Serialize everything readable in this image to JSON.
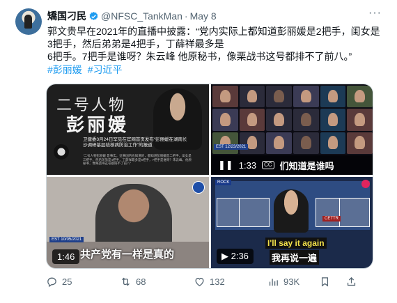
{
  "author": {
    "name": "矯国刁民",
    "handle": "@NFSC_TankMan",
    "separator": "·",
    "date": "May 8"
  },
  "tweet": {
    "lines": [
      "郭文贵早在2021年的直播中披露：“党内实际上都知道彭丽媛是2把手，闺女是",
      "3把手，然后弟弟是4把手，丁薛祥最多是",
      "6把手。7把手是谁呀？朱云峰 他原秘书，像栗战书这号都排不了前八。”"
    ],
    "hashtags": [
      "#彭丽媛",
      "#习近平"
    ]
  },
  "media": {
    "tile1": {
      "heading": "二号人物",
      "name": "彭丽媛",
      "caption": "卫健委3月24日罕见在官网首页发布“彭丽媛在湖南长沙调研基层结核病防治工作”的报道",
      "fine_print": "“二号人物彭丽媛 是事实，这事国内也知道的，都知道彭丽媛是二把手，闺女是三把手，然后弟弟是4把手，丁薛祥最多是6把手，7把手是谁呀？朱云峰，他原秘书，像栗战书这号都排不了前八”"
    },
    "tile2": {
      "est_label": "EST 12/23/2021",
      "duration": "1:33",
      "subtitle": "们知道是谁吗"
    },
    "tile3": {
      "est_label": "EST 10/05/2021",
      "duration": "1:46",
      "subtitle": "共产党有一样是真的"
    },
    "tile4": {
      "network": "ROCK",
      "panel_label": "CETTR",
      "duration": "2:36",
      "subtitle_en": "I'll say it again",
      "subtitle_zh": "我再说一遍"
    }
  },
  "actions": {
    "replies": "25",
    "reposts": "68",
    "likes": "132",
    "views": "93K"
  },
  "colors": {
    "link": "#1d9bf0",
    "muted": "#536471",
    "verified": "#1d9bf0"
  }
}
